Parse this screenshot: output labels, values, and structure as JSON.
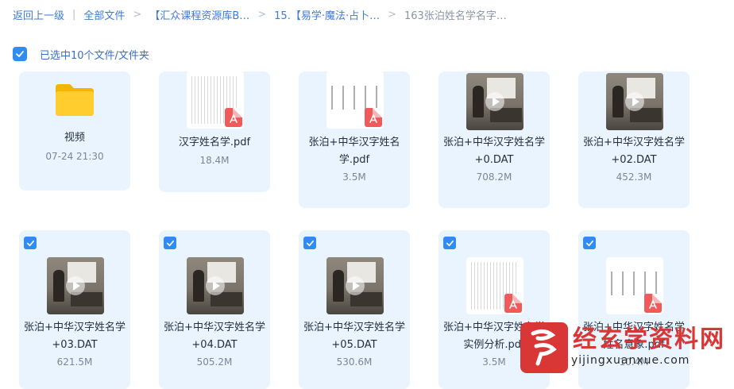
{
  "breadcrumb": {
    "items": [
      "返回上一级",
      "全部文件",
      "【汇众课程资源库B…",
      "15.【易学·魔法·占卜…"
    ],
    "current": "163张泊姓名学名字…",
    "separator": "|",
    "chevron": ">"
  },
  "selection": {
    "label": "已选中10个文件/文件夹",
    "checked": true
  },
  "files": [
    {
      "name": "视频",
      "meta": "07-24 21:30",
      "kind": "folder",
      "icon": "folder-icon",
      "selected": false
    },
    {
      "name": "汉字姓名学.pdf",
      "meta": "18.4M",
      "kind": "pdf",
      "icon": "pdf-icon",
      "selected": false
    },
    {
      "name": "张泊+中华汉字姓名学.pdf",
      "meta": "3.5M",
      "kind": "pdf",
      "icon": "pdf-icon",
      "selected": false
    },
    {
      "name": "张泊+中华汉字姓名学+0.DAT",
      "meta": "708.2M",
      "kind": "video",
      "icon": "play-icon",
      "selected": false
    },
    {
      "name": "张泊+中华汉字姓名学+02.DAT",
      "meta": "452.3M",
      "kind": "video",
      "icon": "play-icon",
      "selected": false
    },
    {
      "name": "张泊+中华汉字姓名学+03.DAT",
      "meta": "621.5M",
      "kind": "video",
      "icon": "play-icon",
      "selected": true
    },
    {
      "name": "张泊+中华汉字姓名学+04.DAT",
      "meta": "505.2M",
      "kind": "video",
      "icon": "play-icon",
      "selected": true
    },
    {
      "name": "张泊+中华汉字姓名学+05.DAT",
      "meta": "530.6M",
      "kind": "video",
      "icon": "play-icon",
      "selected": true
    },
    {
      "name": "张泊+中华汉字姓名学实例分析.pdf",
      "meta": "3.5M",
      "kind": "pdf",
      "icon": "pdf-icon",
      "selected": true
    },
    {
      "name": "张泊+中华汉字姓名学姓名意象.pdf",
      "meta": "10.4M",
      "kind": "pdf",
      "icon": "pdf-icon",
      "selected": true
    }
  ],
  "watermark": {
    "title": "经玄学资料网",
    "url": "yijingxuanxue.com"
  },
  "colors": {
    "accent": "#2f8cf0",
    "card_bg": "#eaf4fe",
    "link": "#3c7bd6",
    "pdf_red": "#f05a5a",
    "watermark_red": "#d93636"
  }
}
